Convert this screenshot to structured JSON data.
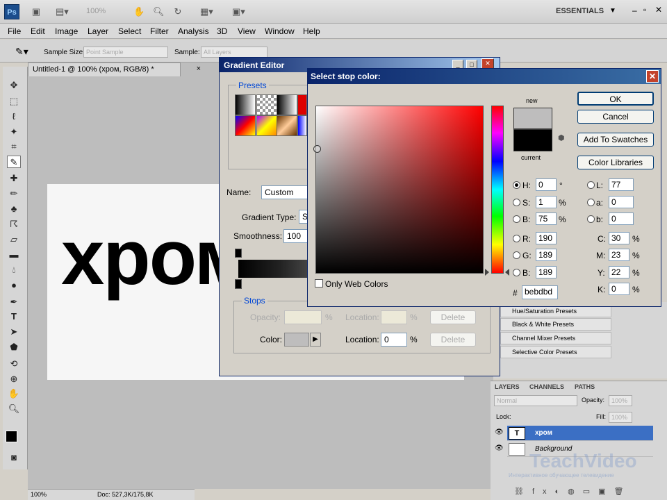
{
  "app": {
    "logo": "Ps",
    "zoom": "100%",
    "workspace": "ESSENTIALS"
  },
  "menu": [
    "File",
    "Edit",
    "Image",
    "Layer",
    "Select",
    "Filter",
    "Analysis",
    "3D",
    "View",
    "Window",
    "Help"
  ],
  "options": {
    "sample_size_label": "Sample Size:",
    "sample_size_value": "Point Sample",
    "sample_label": "Sample:",
    "sample_value": "All Layers"
  },
  "document": {
    "tab": "Untitled-1 @ 100% (хром, RGB/8) *",
    "close": "×",
    "text": "хром",
    "status_zoom": "100%",
    "status_doc": "Doc: 527,3K/175,8K"
  },
  "adjustments": [
    "Hue/Saturation Presets",
    "Black & White Presets",
    "Channel Mixer Presets",
    "Selective Color Presets"
  ],
  "layers": {
    "tabs": [
      "LAYERS",
      "CHANNELS",
      "PATHS"
    ],
    "blend": "Normal",
    "opacity_label": "Opacity:",
    "opacity": "100%",
    "lock_label": "Lock:",
    "fill_label": "Fill:",
    "fill": "100%",
    "rows": [
      {
        "name": "хром",
        "type": "T",
        "selected": true
      },
      {
        "name": "Background",
        "type": "",
        "selected": false
      }
    ],
    "watermark": "TeachVideo",
    "watermark_sub": "Интерактивное обучающее телевидение"
  },
  "gradient_editor": {
    "title": "Gradient Editor",
    "presets_label": "Presets",
    "name_label": "Name:",
    "name_value": "Custom",
    "gradient_type_label": "Gradient Type:",
    "gradient_type_value": "S",
    "smoothness_label": "Smoothness:",
    "smoothness_value": "100",
    "stops_label": "Stops",
    "opacity_label": "Opacity:",
    "opacity_unit": "%",
    "location_label": "Location:",
    "location_unit": "%",
    "delete_label": "Delete",
    "color_label": "Color:",
    "location_value": "0"
  },
  "color_picker": {
    "title": "Select stop color:",
    "new_label": "new",
    "current_label": "current",
    "ok": "OK",
    "cancel": "Cancel",
    "add_to_swatches": "Add To Swatches",
    "color_libraries": "Color Libraries",
    "only_web_colors": "Only Web Colors",
    "H": {
      "label": "H:",
      "value": "0",
      "unit": "°"
    },
    "S": {
      "label": "S:",
      "value": "1",
      "unit": "%"
    },
    "Bv": {
      "label": "B:",
      "value": "75",
      "unit": "%"
    },
    "R": {
      "label": "R:",
      "value": "190"
    },
    "G": {
      "label": "G:",
      "value": "189"
    },
    "Bc": {
      "label": "B:",
      "value": "189"
    },
    "L": {
      "label": "L:",
      "value": "77"
    },
    "a": {
      "label": "a:",
      "value": "0"
    },
    "b": {
      "label": "b:",
      "value": "0"
    },
    "C": {
      "label": "C:",
      "value": "30",
      "unit": "%"
    },
    "M": {
      "label": "M:",
      "value": "23",
      "unit": "%"
    },
    "Y": {
      "label": "Y:",
      "value": "22",
      "unit": "%"
    },
    "K": {
      "label": "K:",
      "value": "0",
      "unit": "%"
    },
    "hex_label": "#",
    "hex": "bebdbd",
    "colors": {
      "new": "#bebdbd",
      "current": "#000000"
    }
  }
}
